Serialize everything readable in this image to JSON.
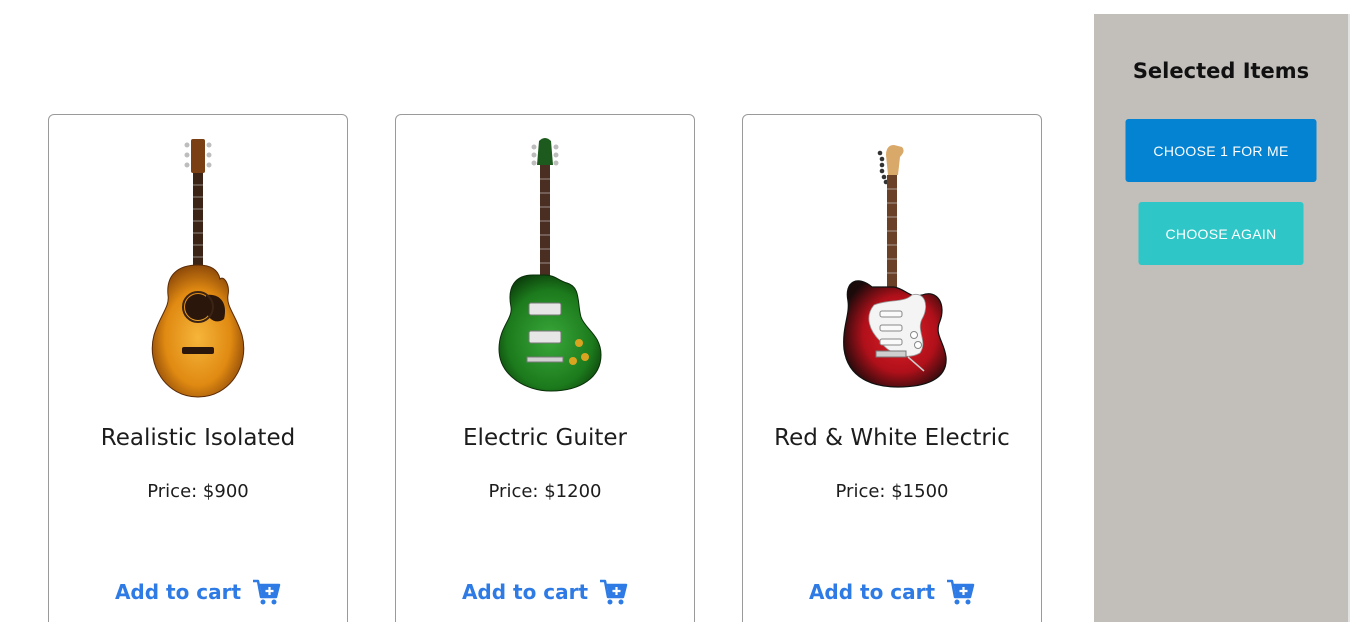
{
  "products": [
    {
      "title": "Realistic Isolated",
      "price": "Price: $900",
      "cta": "Add to cart",
      "image_icon": "acoustic-guitar-icon"
    },
    {
      "title": "Electric Guiter",
      "price": "Price: $1200",
      "cta": "Add to cart",
      "image_icon": "green-electric-guitar-icon"
    },
    {
      "title": "Red & White Electric",
      "price": "Price: $1500",
      "cta": "Add to cart",
      "image_icon": "red-white-electric-guitar-icon"
    }
  ],
  "sidebar": {
    "title": "Selected Items",
    "choose_label": "CHOOSE 1 FOR ME",
    "again_label": "CHOOSE AGAIN"
  },
  "colors": {
    "accent": "#2f7be5",
    "sidebar_bg": "#c2beba",
    "choose_button": "#0383d1",
    "again_button": "#2fc6c8"
  }
}
